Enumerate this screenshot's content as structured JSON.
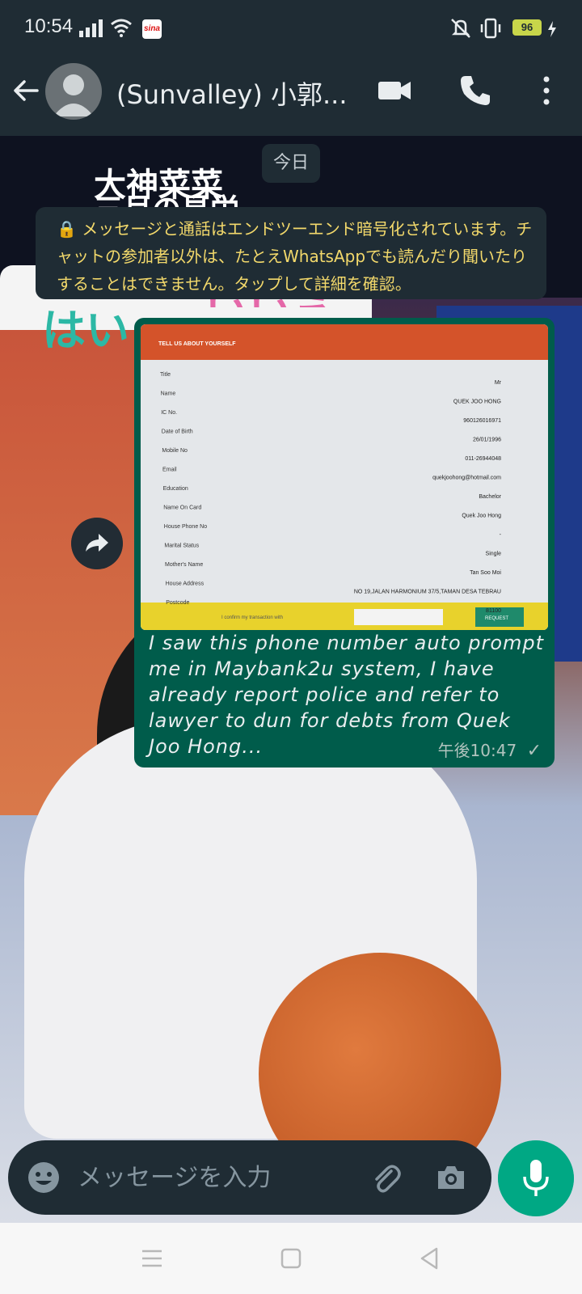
{
  "status_bar": {
    "time": "10:54",
    "battery": "96",
    "sina_badge": "sina"
  },
  "header": {
    "title": "(Sunvalley) 小郭..."
  },
  "wallpaper": {
    "line1": "大神菜菜",
    "line2": "三月の見栄",
    "yes": "はい",
    "no": "いいえ"
  },
  "chat": {
    "date_label": "今日",
    "encryption_notice": "🔒 メッセージと通話はエンドツーエンド暗号化されています。チャットの参加者以外は、たとえWhatsAppでも読んだり聞いたりすることはできません。タップして詳細を確認。",
    "message": {
      "text": "I saw this phone number auto prompt me in Maybank2u system, I have already report police and refer to lawyer to dun for debts from Quek Joo Hong...",
      "time": "午後10:47",
      "status": "✓"
    },
    "form_image": {
      "header": "TELL US ABOUT YOURSELF",
      "rows": [
        {
          "label": "Title",
          "value": "Mr"
        },
        {
          "label": "Name",
          "value": "QUEK JOO HONG"
        },
        {
          "label": "IC No.",
          "value": "960126016971"
        },
        {
          "label": "Date of Birth",
          "value": "26/01/1996"
        },
        {
          "label": "Mobile No",
          "value": "011-26944048"
        },
        {
          "label": "Email",
          "value": "quekjoohong@hotmail.com"
        },
        {
          "label": "Education",
          "value": "Bachelor"
        },
        {
          "label": "Name On Card",
          "value": "Quek Joo Hong"
        },
        {
          "label": "House Phone No",
          "value": "-"
        },
        {
          "label": "Marital Status",
          "value": "Single"
        },
        {
          "label": "Mother's Name",
          "value": "Tan Soo Moi"
        },
        {
          "label": "House Address",
          "value": "NO 19,JALAN HARMONIUM 37/5,TAMAN DESA TEBRAU"
        },
        {
          "label": "Postcode",
          "value": "81100"
        }
      ],
      "footer_text": "I confirm my transaction with",
      "request_label": "REQUEST"
    }
  },
  "composer": {
    "placeholder": "メッセージを入力"
  },
  "colors": {
    "header_bg": "#1f2c34",
    "bubble_bg": "#005c4b",
    "accent": "#00a884",
    "notice_text": "#f3d96b"
  }
}
